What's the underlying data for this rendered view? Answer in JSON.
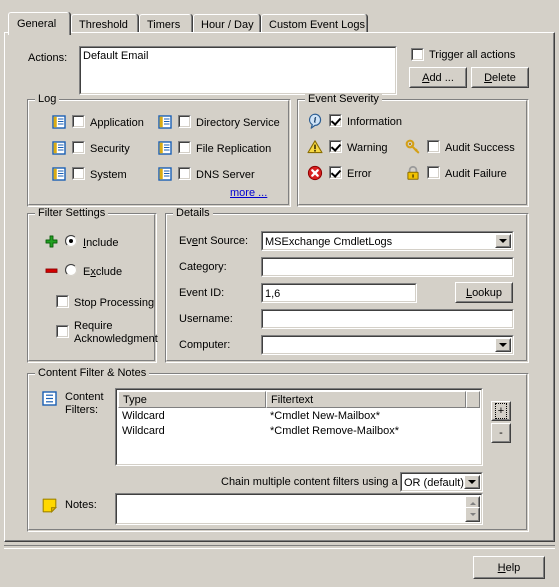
{
  "window": {
    "tabs": [
      {
        "label": "General",
        "active": true
      },
      {
        "label": "Threshold",
        "active": false
      },
      {
        "label": "Timers",
        "active": false
      },
      {
        "label": "Hour / Day",
        "active": false
      },
      {
        "label": "Custom Event Logs",
        "active": false
      }
    ]
  },
  "actions": {
    "label": "Actions:",
    "value": "Default Email",
    "trigger_all_label": "Trigger all actions",
    "trigger_all_checked": false,
    "add_label": "Add ...",
    "delete_label": "Delete"
  },
  "log": {
    "title": "Log",
    "more_label": "more ...",
    "items": [
      {
        "label": "Application",
        "checked": false,
        "icon": "log-icon"
      },
      {
        "label": "Security",
        "checked": false,
        "icon": "log-icon"
      },
      {
        "label": "System",
        "checked": false,
        "icon": "log-icon"
      },
      {
        "label": "Directory Service",
        "checked": false,
        "icon": "log-icon"
      },
      {
        "label": "File Replication",
        "checked": false,
        "icon": "log-icon"
      },
      {
        "label": "DNS Server",
        "checked": false,
        "icon": "log-icon"
      }
    ]
  },
  "event_severity": {
    "title": "Event Severity",
    "items": [
      {
        "label": "Information",
        "checked": true,
        "icon": "information-icon"
      },
      {
        "label": "Warning",
        "checked": true,
        "icon": "warning-icon"
      },
      {
        "label": "Error",
        "checked": true,
        "icon": "error-icon"
      },
      {
        "label": "Audit Success",
        "checked": false,
        "icon": "key-icon"
      },
      {
        "label": "Audit Failure",
        "checked": false,
        "icon": "lock-icon"
      }
    ]
  },
  "filter_settings": {
    "title": "Filter Settings",
    "include_label": "Include",
    "include_selected": true,
    "exclude_label": "Exclude",
    "exclude_selected": false,
    "stop_processing_label": "Stop Processing",
    "stop_processing_checked": false,
    "require_ack_label_line1": "Require",
    "require_ack_label_line2": "Acknowledgment",
    "require_ack_checked": false
  },
  "details": {
    "title": "Details",
    "fields": [
      {
        "label": "Event Source:",
        "value": "MSExchange CmdletLogs",
        "type": "combo"
      },
      {
        "label": "Category:",
        "value": "",
        "type": "text"
      },
      {
        "label": "Event ID:",
        "value": "1,6",
        "type": "text"
      },
      {
        "label": "Username:",
        "value": "",
        "type": "text"
      },
      {
        "label": "Computer:",
        "value": "",
        "type": "combo"
      }
    ],
    "lookup_label": "Lookup"
  },
  "content_filter": {
    "title": "Content Filter & Notes",
    "content_filters_label_line1": "Content",
    "content_filters_label_line2": "Filters:",
    "columns": [
      "Type",
      "Filtertext",
      ""
    ],
    "rows": [
      [
        "Wildcard",
        "*Cmdlet New-Mailbox*",
        ""
      ],
      [
        "Wildcard",
        "*Cmdlet Remove-Mailbox*",
        ""
      ]
    ],
    "add_row_label": "+",
    "remove_row_label": "-",
    "chain_label": "Chain multiple content filters using a",
    "chain_value": "OR (default)",
    "notes_label": "Notes:",
    "notes_value": ""
  },
  "footer": {
    "help_label": "Help"
  },
  "colors": {
    "face": "#d4d0c8",
    "link": "#0000d0",
    "error": "#d40000",
    "warning": "#ffcc00",
    "info": "#4a7ebb",
    "gold": "#e8c24a",
    "green": "#21a021"
  }
}
